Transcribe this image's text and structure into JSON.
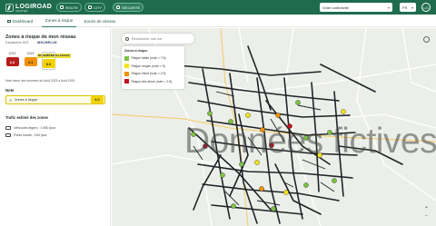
{
  "app": {
    "logo": "LOGIROAD",
    "logo_sub": "CENTER"
  },
  "topnav": {
    "pills": [
      {
        "label": "ROUTE",
        "icon": "road-icon"
      },
      {
        "label": "CITY",
        "icon": "city-icon"
      },
      {
        "label": "SÉCURITÉ",
        "icon": "shield-icon"
      }
    ],
    "collectivity": "Votre collectivité",
    "language": "FR",
    "user_initials": "LG"
  },
  "tabs": [
    {
      "label": "Dashboard",
      "icon": "dashboard-icon"
    },
    {
      "label": "Zones à risque",
      "active": true
    },
    {
      "label": "Excès de vitesse"
    }
  ],
  "panel": {
    "title": "Zones à risque de mon réseau",
    "date": "8 septembre 2021",
    "brand_top": "MICHELIN",
    "brand_bottom": "MOBILITY INTELLIGENCE",
    "years": [
      {
        "year": "2022",
        "score": "2.2",
        "color": "#b81d1d",
        "text": "#ffffff"
      },
      {
        "year": "2023",
        "score": "4.1",
        "color": "#f29100",
        "text": "#1f2a24"
      },
      {
        "year": "2024",
        "score": "6.0",
        "color": "#f3d200",
        "text": "#1f2a24"
      }
    ],
    "note_source": "Note issue des données de Août 2023 à Août 2024",
    "note_heading": "Note",
    "zone_label": "Zones à risque",
    "zone_score": "6.0",
    "traffic_heading": "Trafic estimé des zones",
    "traffic": [
      {
        "label": "Véhicules légers : 1 650 /jour"
      },
      {
        "label": "Poids lourds : 184 /jour"
      }
    ]
  },
  "map": {
    "search_placeholder": "Rechercher une rue",
    "legend_title": "Zones à risque",
    "legend": [
      {
        "label": "Risque faible (note > 7.5)",
        "color": "#7cc142"
      },
      {
        "label": "Risque moyen (note > 5)",
        "color": "#f3e21a"
      },
      {
        "label": "Risque élevé (note > 2.5)",
        "color": "#f29100"
      },
      {
        "label": "Risque très élevé (note < 2.5)",
        "color": "#c1121f"
      }
    ],
    "watermark": "Données fictives",
    "zoom_in": "+",
    "zoom_out": "−"
  }
}
